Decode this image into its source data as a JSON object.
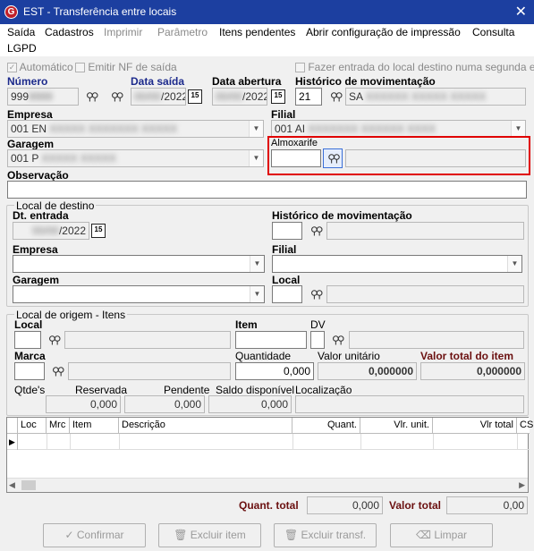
{
  "window": {
    "title": "EST - Transferência entre locais",
    "close": "✕"
  },
  "menu": [
    "Saída",
    "Cadastros",
    "Imprimir",
    "Parâmetro",
    "Itens pendentes",
    "Abrir configuração de impressão",
    "Consulta",
    "LGPD"
  ],
  "options": {
    "automatico": "Automático",
    "emitir_nf": "Emitir NF de saída",
    "segunda_etapa": "Fazer entrada do local destino numa segunda etapa"
  },
  "header": {
    "numero_label": "Número",
    "numero_value": "999",
    "data_saida_label": "Data saída",
    "data_saida_value": "/2022",
    "data_abertura_label": "Data abertura",
    "data_abertura_value": "/2022",
    "historico_label": "Histórico de movimentação",
    "historico_code": "21",
    "historico_desc": "SA",
    "empresa_label": "Empresa",
    "empresa_value": "001 EN",
    "filial_label": "Filial",
    "filial_value": "001 AI",
    "garagem_label": "Garagem",
    "garagem_value": "001 P",
    "almoxarife_label": "Almoxarife",
    "observacao_label": "Observação"
  },
  "destino": {
    "group_label": "Local de destino",
    "dt_entrada_label": "Dt. entrada",
    "dt_entrada_value": "/2022",
    "historico_label": "Histórico de movimentação",
    "empresa_label": "Empresa",
    "filial_label": "Filial",
    "garagem_label": "Garagem",
    "local_label": "Local"
  },
  "origem": {
    "group_label": "Local de origem - Itens",
    "local_label": "Local",
    "item_label": "Item",
    "dv_label": "DV",
    "marca_label": "Marca",
    "quantidade_label": "Quantidade",
    "quantidade_value": "0,000",
    "valor_unitario_label": "Valor unitário",
    "valor_unitario_value": "0,000000",
    "valor_total_item_label": "Valor total do item",
    "valor_total_item_value": "0,000000",
    "qtdes_label": "Qtde's",
    "reservada_label": "Reservada",
    "reservada_value": "0,000",
    "pendente_label": "Pendente",
    "pendente_value": "0,000",
    "saldo_label": "Saldo disponível",
    "saldo_value": "0,000",
    "localizacao_label": "Localização"
  },
  "grid": {
    "columns": [
      "Loc",
      "Mrc",
      "Item",
      "Descrição",
      "Quant.",
      "Vlr. unit.",
      "Vlr total",
      "CS"
    ]
  },
  "totals": {
    "quant_total_label": "Quant. total",
    "quant_total_value": "0,000",
    "valor_total_label": "Valor total",
    "valor_total_value": "0,00"
  },
  "buttons": {
    "confirmar": "Confirmar",
    "excluir_item": "Excluir item",
    "excluir_transf": "Excluir transf.",
    "limpar": "Limpar"
  },
  "colors": {
    "titlebar": "#1c3fa0",
    "highlight": "#e00000",
    "label_blue": "#1c2a8c",
    "label_dark_red": "#6b1010"
  }
}
